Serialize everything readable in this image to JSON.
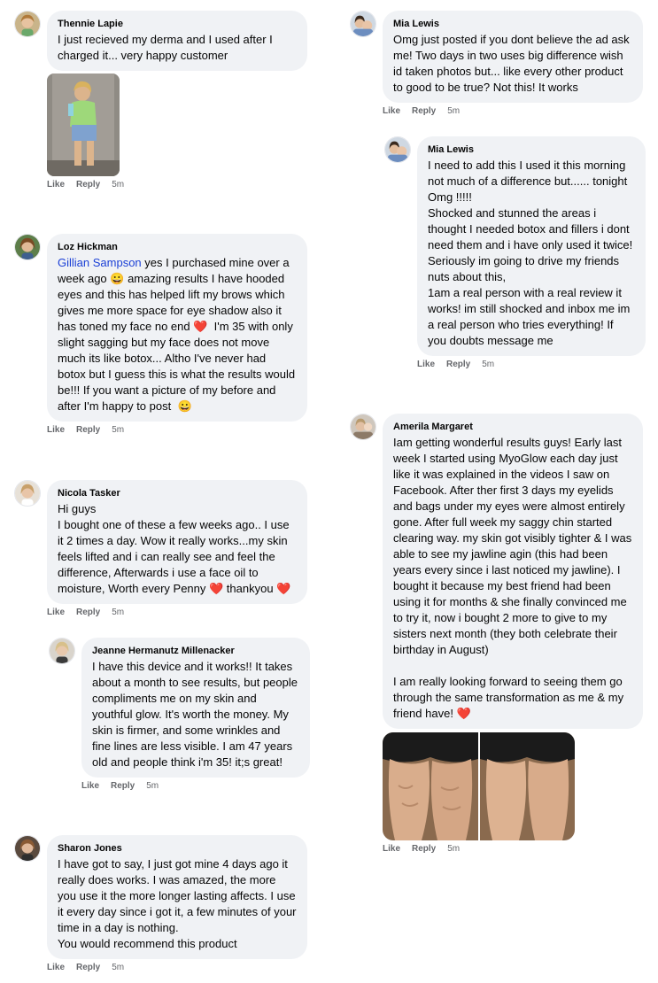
{
  "actions": {
    "like": "Like",
    "reply": "Reply"
  },
  "comments": [
    {
      "author": "Thennie Lapie",
      "text": "I just recieved my derma and I used after I charged it... very happy customer",
      "time": "5m"
    },
    {
      "author": "Loz Hickman",
      "mention": "Gillian Sampson",
      "text_a": " yes I purchased mine over a week ago ",
      "text_b": " amazing results I have hooded eyes and this has helped lift my brows which gives me more space for eye shadow also it has toned my face no end ",
      "text_c": "  I'm 35 with only slight sagging but my face does not move much its like botox... Altho I've never had botox but I guess this is what the results would be!!! If you want a picture of my before and after I'm happy to post  ",
      "time": "5m"
    },
    {
      "author": "Nicola Tasker",
      "text_a": "Hi guys\nI bought one of these a few weeks ago.. I use it 2 times a day. Wow it really works...my skin feels lifted and i can really see and feel the difference, Afterwards i use a face oil to moisture, Worth every Penny ",
      "text_b": " thankyou ",
      "time": "5m"
    },
    {
      "author": "Jeanne Hermanutz Millenacker",
      "text": "I have this device and it works!! It takes about a month to see results, but people compliments me on my skin and youthful glow. It's worth the money. My skin is firmer, and some wrinkles and fine lines are less visible. I am 47 years old and people think i'm 35! it;s great!",
      "time": "5m"
    },
    {
      "author": "Sharon Jones",
      "text": "I have got to say, I just got mine 4 days ago it really does works. I was amazed, the more you use it the more longer lasting affects. I use it every day since i got it, a few minutes of your time in a day is nothing.\nYou would recommend this product",
      "time": "5m"
    },
    {
      "author": "Mia Lewis",
      "text": "Omg just posted if you dont believe the ad ask me! Two days in two uses big difference wish id taken photos but... like every other product to good to be true? Not this! It works",
      "time": "5m"
    },
    {
      "author": "Mia Lewis",
      "text": "I need to add this I used it this morning not much of a difference but...... tonight Omg !!!!!\nShocked and stunned the areas i thought I needed botox and fillers i dont need them and i have only used it twice! Seriously im going to drive my friends nuts about this,\n1am a real person with a real review it works! im still shocked and inbox me im a real person who tries everything! If you doubts message me",
      "time": "5m"
    },
    {
      "author": "Amerila Margaret",
      "text_a": "Iam getting wonderful results guys! Early last week I started using MyoGlow each day just like it was explained in the videos I saw on Facebook. After ther first 3 days my eyelids and bags under my eyes were almost entirely gone. After full week my saggy chin started clearing way. my skin got visibly tighter & I was able to see my jawline agin (this had been years every since i last noticed my jawline). I bought it because my best friend had been using it for months & she finally convinced me to try it, now i bought 2 more to give to my sisters next month (they both celebrate their birthday in August)\n\nI am really looking forward to seeing them go through the same transformation as me & my friend have! ",
      "time": "5m"
    }
  ],
  "emoji": {
    "grin": "😀",
    "heart": "❤️"
  },
  "colors": {
    "bubble": "#f0f2f5",
    "meta": "#65676b",
    "mention": "#1a3fd6"
  }
}
